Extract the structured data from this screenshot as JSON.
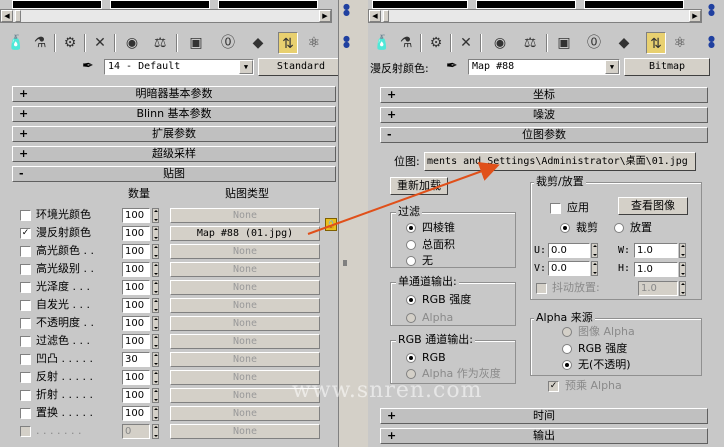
{
  "left": {
    "material_name": "14 - Default",
    "material_type": "Standard",
    "rollouts": [
      {
        "sign": "+",
        "title": "明暗器基本参数"
      },
      {
        "sign": "+",
        "title": "Blinn 基本参数"
      },
      {
        "sign": "+",
        "title": "扩展参数"
      },
      {
        "sign": "+",
        "title": "超级采样"
      },
      {
        "sign": "-",
        "title": "贴图"
      }
    ],
    "maps": {
      "col_amount": "数量",
      "col_type": "贴图类型",
      "rows": [
        {
          "label": "环境光颜色",
          "checked": false,
          "amount": "100",
          "map": "None"
        },
        {
          "label": "漫反射颜色",
          "checked": true,
          "amount": "100",
          "map": "Map #88 (01.jpg)"
        },
        {
          "label": "高光颜色 . .",
          "checked": false,
          "amount": "100",
          "map": "None"
        },
        {
          "label": "高光级别 . .",
          "checked": false,
          "amount": "100",
          "map": "None"
        },
        {
          "label": "光泽度 . . .",
          "checked": false,
          "amount": "100",
          "map": "None"
        },
        {
          "label": "自发光 . . .",
          "checked": false,
          "amount": "100",
          "map": "None"
        },
        {
          "label": "不透明度 . .",
          "checked": false,
          "amount": "100",
          "map": "None"
        },
        {
          "label": "过滤色 . . .",
          "checked": false,
          "amount": "100",
          "map": "None"
        },
        {
          "label": "凹凸 . . . . .",
          "checked": false,
          "amount": "30",
          "map": "None"
        },
        {
          "label": "反射 . . . . .",
          "checked": false,
          "amount": "100",
          "map": "None"
        },
        {
          "label": "折射 . . . . .",
          "checked": false,
          "amount": "100",
          "map": "None"
        },
        {
          "label": "置换 . . . . .",
          "checked": false,
          "amount": "100",
          "map": "None"
        },
        {
          "label": ". . . . . . .",
          "checked": false,
          "amount": "0",
          "map": "None"
        }
      ]
    }
  },
  "right": {
    "slot_label": "漫反射颜色:",
    "map_name": "Map #88",
    "map_type": "Bitmap",
    "rollouts_top": [
      {
        "sign": "+",
        "title": "坐标"
      },
      {
        "sign": "+",
        "title": "噪波"
      },
      {
        "sign": "-",
        "title": "位图参数"
      }
    ],
    "rollouts_bottom": [
      {
        "sign": "+",
        "title": "时间"
      },
      {
        "sign": "+",
        "title": "输出"
      }
    ],
    "bitmap": {
      "label": "位图:",
      "path": "ments and Settings\\Administrator\\桌面\\01.jpg",
      "reload": "重新加载",
      "filter": {
        "title": "过滤",
        "options": [
          "四棱锥",
          "总面积",
          "无"
        ],
        "selected": 0
      },
      "mono": {
        "title": "单通道输出:",
        "options": [
          "RGB 强度",
          "Alpha"
        ],
        "selected": 0
      },
      "rgb": {
        "title": "RGB 通道输出:",
        "options": [
          "RGB",
          "Alpha 作为灰度"
        ],
        "selected": 0
      },
      "crop": {
        "title": "裁剪/放置",
        "apply": "应用",
        "view_image": "查看图像",
        "mode_options": [
          "裁剪",
          "放置"
        ],
        "mode_selected": 0,
        "u": "0.0",
        "v": "0.0",
        "w": "1.0",
        "h": "1.0",
        "u_label": "U:",
        "v_label": "V:",
        "w_label": "W:",
        "h_label": "H:",
        "jitter": "抖动放置:",
        "jitter_value": "1.0"
      },
      "alpha": {
        "title": "Alpha 来源",
        "options": [
          "图像 Alpha",
          "RGB 强度",
          "无(不透明)"
        ],
        "selected": 2
      },
      "premult": "预乘 Alpha"
    }
  },
  "watermark": "www.snren.com",
  "colors": {
    "arrow": "#e0501a",
    "rollout": "#c0c0c0",
    "panel": "#c8c8c8",
    "highlight": "#e8d070"
  }
}
